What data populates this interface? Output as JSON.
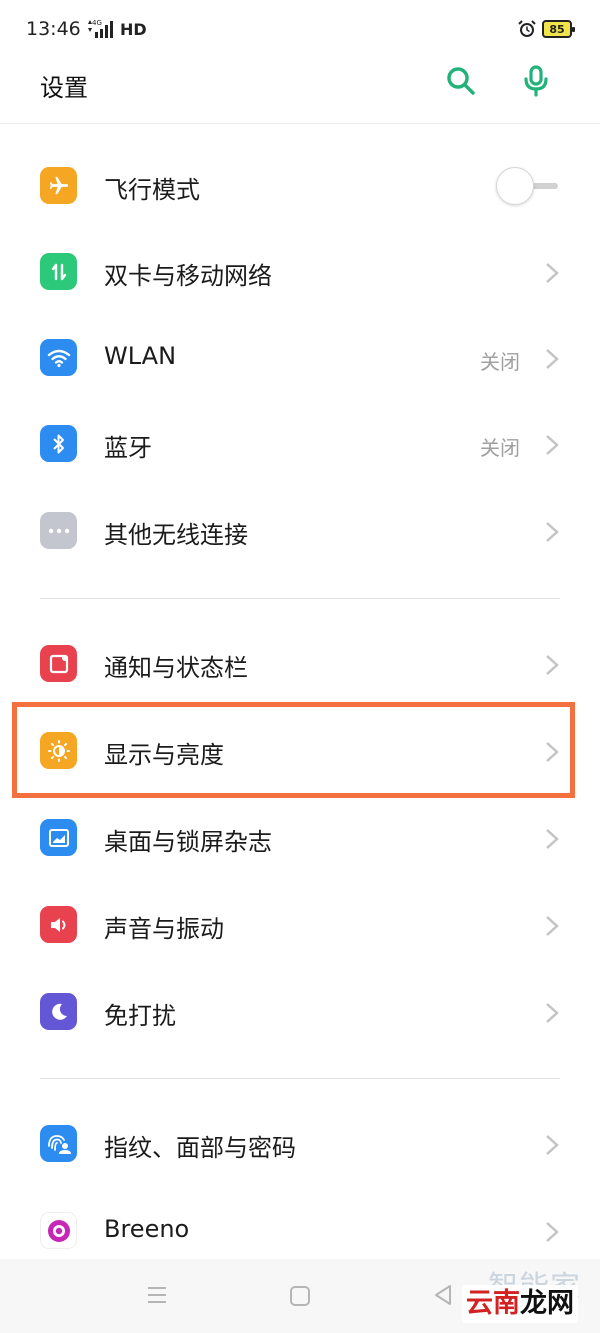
{
  "status_bar": {
    "time": "13:46",
    "network": "4G",
    "hd": "HD",
    "battery": "85"
  },
  "header": {
    "title": "设置"
  },
  "groups": [
    {
      "items": [
        {
          "label": "飞行模式",
          "icon": "airplane-icon",
          "color": "#F5A623",
          "control": "toggle",
          "toggle_on": false
        },
        {
          "label": "双卡与移动网络",
          "icon": "dual-sim-icon",
          "color": "#2DC97A",
          "control": "chevron"
        },
        {
          "label": "WLAN",
          "icon": "wifi-icon",
          "color": "#2D8CF0",
          "status": "关闭",
          "control": "chevron"
        },
        {
          "label": "蓝牙",
          "icon": "bluetooth-icon",
          "color": "#2D8CF0",
          "status": "关闭",
          "control": "chevron"
        },
        {
          "label": "其他无线连接",
          "icon": "more-icon",
          "color": "#C3C6CE",
          "control": "chevron"
        }
      ]
    },
    {
      "items": [
        {
          "label": "通知与状态栏",
          "icon": "notification-icon",
          "color": "#E8424E",
          "control": "chevron"
        },
        {
          "label": "显示与亮度",
          "icon": "brightness-icon",
          "color": "#F5A623",
          "control": "chevron",
          "highlighted": true
        },
        {
          "label": "桌面与锁屏杂志",
          "icon": "wallpaper-icon",
          "color": "#2D8CF0",
          "control": "chevron"
        },
        {
          "label": "声音与振动",
          "icon": "sound-icon",
          "color": "#E8424E",
          "control": "chevron"
        },
        {
          "label": "免打扰",
          "icon": "moon-icon",
          "color": "#6457D6",
          "control": "chevron"
        }
      ]
    },
    {
      "items": [
        {
          "label": "指纹、面部与密码",
          "icon": "fingerprint-face-icon",
          "color": "#2D8CF0",
          "control": "chevron"
        },
        {
          "label": "Breeno",
          "icon": "breeno-icon",
          "color": "#C727B6",
          "control": "chevron"
        }
      ]
    }
  ],
  "highlight_color": "#F4713F",
  "watermark": {
    "top": "智能家",
    "bottom_part1": "云南",
    "bottom_part2": "龙网"
  }
}
